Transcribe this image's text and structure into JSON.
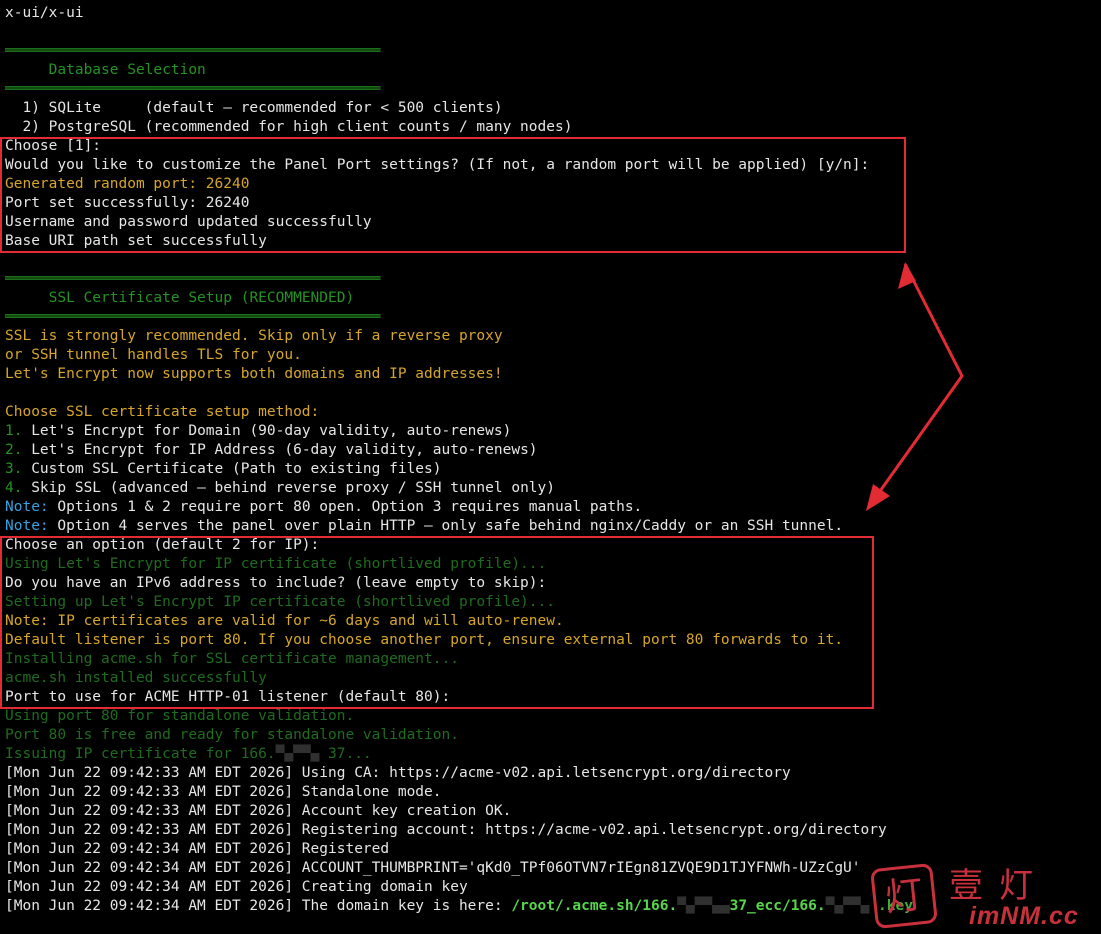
{
  "header": {
    "title": "x-ui/x-ui"
  },
  "db_section": {
    "rule": "═══════════════════════════════════════════",
    "title": "Database Selection",
    "options": [
      "  1) SQLite     (default — recommended for < 500 clients)",
      "  2) PostgreSQL (recommended for high client counts / many nodes)"
    ]
  },
  "panel_block": {
    "choose": "Choose [1]:",
    "customize_prompt": "Would you like to customize the Panel Port settings? (If not, a random port will be applied) [y/n]:",
    "generated_port": "Generated random port: 26240",
    "port_set": "Port set successfully: 26240",
    "credentials": "Username and password updated successfully",
    "base_uri": "Base URI path set successfully"
  },
  "ssl_section": {
    "rule": "═══════════════════════════════════════════",
    "title": "SSL Certificate Setup (RECOMMENDED)",
    "intro": [
      "SSL is strongly recommended. Skip only if a reverse proxy",
      "or SSH tunnel handles TLS for you.",
      "Let's Encrypt now supports both domains and IP addresses!"
    ],
    "method_prompt": "Choose SSL certificate setup method:",
    "methods": [
      {
        "num": "1.",
        "text": " Let's Encrypt for Domain (90-day validity, auto-renews)"
      },
      {
        "num": "2.",
        "text": " Let's Encrypt for IP Address (6-day validity, auto-renews)"
      },
      {
        "num": "3.",
        "text": " Custom SSL Certificate (Path to existing files)"
      },
      {
        "num": "4.",
        "text": " Skip SSL (advanced — behind reverse proxy / SSH tunnel only)"
      }
    ],
    "notes": [
      {
        "label": "Note:",
        "text": " Options 1 & 2 require port 80 open. Option 3 requires manual paths."
      },
      {
        "label": "Note:",
        "text": " Option 4 serves the panel over plain HTTP — only safe behind nginx/Caddy or an SSH tunnel."
      }
    ]
  },
  "option_block": {
    "choose_option": "Choose an option (default 2 for IP):",
    "using_le": "Using Let's Encrypt for IP certificate (shortlived profile)...",
    "ipv6_prompt": "Do you have an IPv6 address to include? (leave empty to skip):",
    "setting_up": "Setting up Let's Encrypt IP certificate (shortlived profile)...",
    "note_valid": "Note: IP certificates are valid for ~6 days and will auto-renew.",
    "default_listener": "Default listener is port 80. If you choose another port, ensure external port 80 forwards to it.",
    "installing_acme": "Installing acme.sh for SSL certificate management...",
    "acme_installed": "acme.sh installed successfully",
    "acme_port_prompt": "Port to use for ACME HTTP-01 listener (default 80):"
  },
  "after_block": {
    "using_port": "Using port 80 for standalone validation.",
    "port_free": "Port 80 is free and ready for standalone validation.",
    "issuing_prefix": "Issuing IP certificate for 166.",
    "issuing_redacted": "▀▄▀▀▄ ",
    "issuing_suffix": "37..."
  },
  "log_lines": [
    "[Mon Jun 22 09:42:33 AM EDT 2026] Using CA: https://acme-v02.api.letsencrypt.org/directory",
    "[Mon Jun 22 09:42:33 AM EDT 2026] Standalone mode.",
    "[Mon Jun 22 09:42:33 AM EDT 2026] Account key creation OK.",
    "[Mon Jun 22 09:42:33 AM EDT 2026] Registering account: https://acme-v02.api.letsencrypt.org/directory",
    "[Mon Jun 22 09:42:34 AM EDT 2026] Registered",
    "[Mon Jun 22 09:42:34 AM EDT 2026] ACCOUNT_THUMBPRINT='qKd0_TPf06OTVN7rIEgn81ZVQE9D1TJYFNWh-UZzCgU'",
    "[Mon Jun 22 09:42:34 AM EDT 2026] Creating domain key"
  ],
  "last_line": {
    "prefix": "[Mon Jun 22 09:42:34 AM EDT 2026] The domain key is here: ",
    "path_a": "/root/.acme.sh/166.",
    "redacted_a": "▀▄▀▀▄▄",
    "path_b": "37_ecc/166.",
    "redacted_b": "▀▄▀▀▄ ",
    "path_c": ".key"
  },
  "watermark": {
    "logo_char": "灯",
    "cn": "壹灯",
    "en": "imNM.cc"
  },
  "colors": {
    "background": "#000000",
    "text": "#e6e6e6",
    "green": "#239323",
    "yellow": "#d7a629",
    "blue": "#3aa0e0",
    "highlight_box": "#e22b33",
    "watermark": "#c8303c"
  }
}
